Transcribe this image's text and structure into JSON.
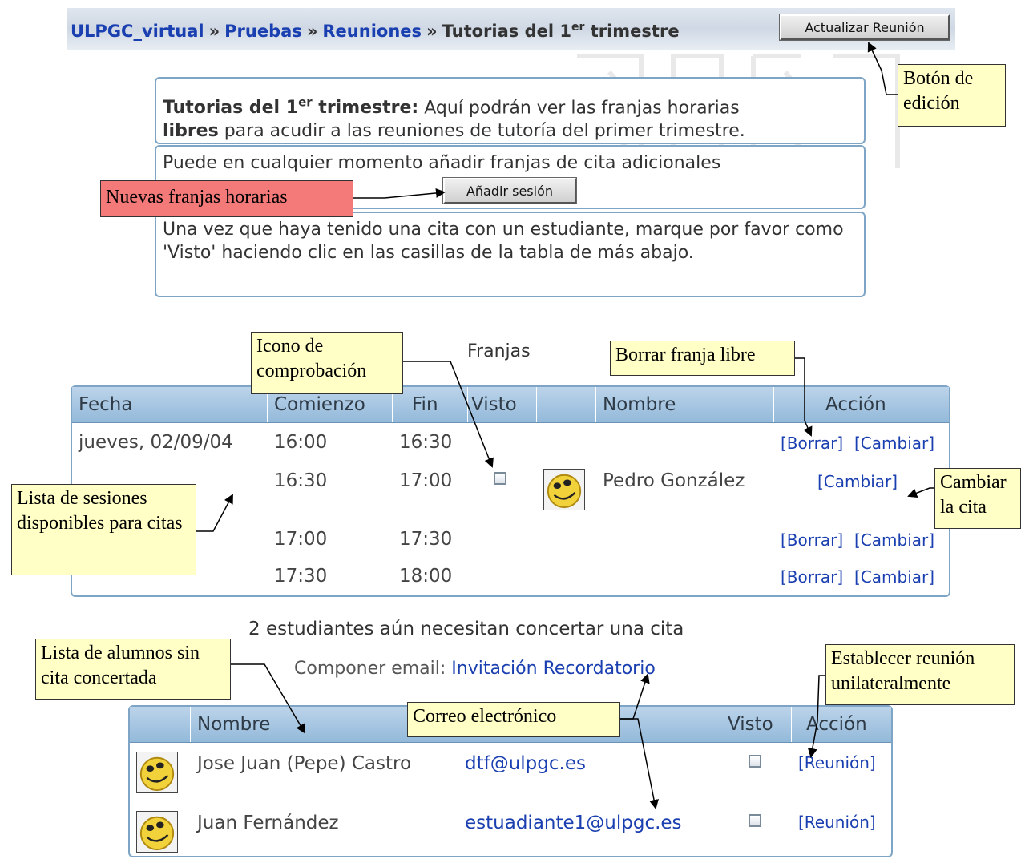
{
  "breadcrumb": {
    "items": [
      "ULPGC_virtual",
      "Pruebas",
      "Reuniones"
    ],
    "separator": "»",
    "current": "Tutorias del 1",
    "current_sup": "er",
    "current_suffix": " trimestre"
  },
  "buttons": {
    "update_meeting": "Actualizar Reunión",
    "add_session": "Añadir sesión"
  },
  "info_boxes": {
    "intro_title": "Tutorias del 1",
    "intro_title_sup": "er",
    "intro_title_suffix": " trimestre:",
    "intro_text_1": " Aquí podrán ver las franjas horarias",
    "intro_bold": "libres",
    "intro_text_2": " para acudir a las reuniones de tutoría del primer trimestre.",
    "add_text": "Puede en cualquier momento añadir franjas de cita adicionales",
    "seen_text": "Una vez que haya tenido una cita con un estudiante, marque por favor como 'Visto' haciendo clic en las casillas de la tabla de más abajo."
  },
  "slots": {
    "title": "Franjas",
    "headers": [
      "Fecha",
      "Comienzo",
      "Fin",
      "Visto",
      "",
      "Nombre",
      "Acción"
    ],
    "rows": [
      {
        "date": "jueves, 02/09/04",
        "start": "16:00",
        "end": "16:30",
        "name": "",
        "actions": [
          "[Borrar]",
          "[Cambiar]"
        ]
      },
      {
        "date": "",
        "start": "16:30",
        "end": "17:00",
        "name": "Pedro González",
        "actions": [
          "[Cambiar]"
        ]
      },
      {
        "date": "",
        "start": "17:00",
        "end": "17:30",
        "name": "",
        "actions": [
          "[Borrar]",
          "[Cambiar]"
        ]
      },
      {
        "date": "",
        "start": "17:30",
        "end": "18:00",
        "name": "",
        "actions": [
          "[Borrar]",
          "[Cambiar]"
        ]
      }
    ]
  },
  "students": {
    "heading": "2 estudiantes aún necesitan concertar una cita",
    "compose_label": "Componer email:",
    "compose_links": [
      "Invitación",
      "Recordatorio"
    ],
    "headers": [
      "",
      "Nombre",
      "Visto",
      "Acción"
    ],
    "rows": [
      {
        "name": "Jose Juan (Pepe) Castro",
        "email": "dtf@ulpgc.es",
        "action": "[Reunión]"
      },
      {
        "name": "Juan Fernández",
        "email": "estuadiante1@ulpgc.es",
        "action": "[Reunión]"
      }
    ]
  },
  "callouts": {
    "edit_button": "Botón de edición",
    "new_slots": "Nuevas franjas horarias",
    "check_icon": "Icono de comprobación",
    "delete_free_slot": "Borrar franja libre",
    "change_appointment": "Cambiar la cita",
    "session_list": "Lista de sesiones disponibles para citas",
    "students_list": "Lista de alumnos sin cita concertada",
    "email": "Correo electrónico",
    "unilateral_meeting": "Establecer reunión unilateralmente"
  },
  "colors": {
    "link": "#1a3fb0",
    "table_header": "#a8c6e2",
    "callout_yellow": "#ffffc6",
    "callout_red": "#f47a7a",
    "border": "#7ea5c5"
  }
}
